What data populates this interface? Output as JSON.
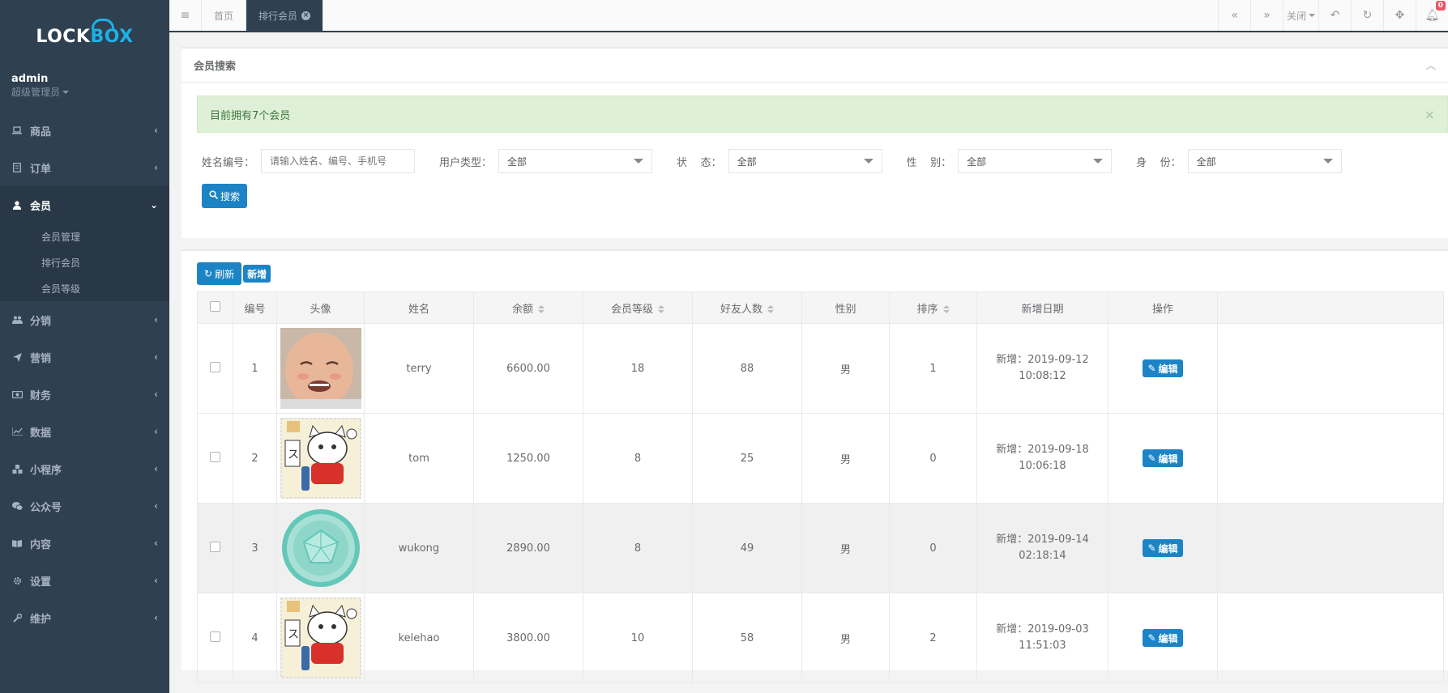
{
  "brand": {
    "logo_part1": "LOCK",
    "logo_part2": "BOX"
  },
  "profile": {
    "username": "admin",
    "role": "超级管理员"
  },
  "sidebar": {
    "items": [
      {
        "label": "商品",
        "icon": "laptop-icon"
      },
      {
        "label": "订单",
        "icon": "list-icon"
      },
      {
        "label": "会员",
        "icon": "user-icon",
        "expanded": true,
        "children": [
          {
            "label": "会员管理"
          },
          {
            "label": "排行会员"
          },
          {
            "label": "会员等级"
          }
        ]
      },
      {
        "label": "分销",
        "icon": "users-icon"
      },
      {
        "label": "营销",
        "icon": "paper-plane-icon"
      },
      {
        "label": "财务",
        "icon": "money-icon"
      },
      {
        "label": "数据",
        "icon": "line-chart-icon"
      },
      {
        "label": "小程序",
        "icon": "cubes-icon"
      },
      {
        "label": "公众号",
        "icon": "wechat-icon"
      },
      {
        "label": "内容",
        "icon": "book-icon"
      },
      {
        "label": "设置",
        "icon": "gear-icon"
      },
      {
        "label": "维护",
        "icon": "wrench-icon"
      }
    ]
  },
  "topbar": {
    "tabs": [
      {
        "label": "首页"
      },
      {
        "label": "排行会员",
        "active": true
      }
    ],
    "close_label": "关闭",
    "notification_count": "0"
  },
  "search": {
    "title": "会员搜索",
    "alert": "目前拥有7个会员",
    "filters": {
      "name_label": "姓名编号：",
      "name_placeholder": "请输入姓名、编号、手机号",
      "type_label": "用户类型：",
      "type_value": "全部",
      "status_label": "状    态：",
      "status_value": "全部",
      "gender_label": "性    别：",
      "gender_value": "全部",
      "identity_label": "身    份：",
      "identity_value": "全部"
    },
    "search_button": "搜索"
  },
  "list": {
    "refresh_button": "刷新",
    "add_button": "新增",
    "columns": [
      "编号",
      "头像",
      "姓名",
      "余额",
      "会员等级",
      "好友人数",
      "性别",
      "排序",
      "新增日期",
      "操作"
    ],
    "rows": [
      {
        "id": "1",
        "avatar": "baby-photo",
        "name": "terry",
        "balance": "6600.00",
        "level": "18",
        "friends": "88",
        "gender": "男",
        "sort": "1",
        "date": "新增：2019-09-12",
        "time": "10:08:12",
        "edit": "编辑"
      },
      {
        "id": "2",
        "avatar": "lucky-cat-stamp",
        "name": "tom",
        "balance": "1250.00",
        "level": "8",
        "friends": "25",
        "gender": "男",
        "sort": "0",
        "date": "新增：2019-09-18",
        "time": "10:06:18",
        "edit": "编辑"
      },
      {
        "id": "3",
        "avatar": "pentagon-badge",
        "name": "wukong",
        "balance": "2890.00",
        "level": "8",
        "friends": "49",
        "gender": "男",
        "sort": "0",
        "date": "新增：2019-09-14",
        "time": "02:18:14",
        "edit": "编辑"
      },
      {
        "id": "4",
        "avatar": "lucky-cat-stamp",
        "name": "kelehao",
        "balance": "3800.00",
        "level": "10",
        "friends": "58",
        "gender": "男",
        "sort": "2",
        "date": "新增：2019-09-03",
        "time": "11:51:03",
        "edit": "编辑"
      }
    ]
  },
  "colors": {
    "sidebar_bg": "#2f4050",
    "accent": "#1c84c6",
    "alert_bg": "#dff0d8"
  }
}
